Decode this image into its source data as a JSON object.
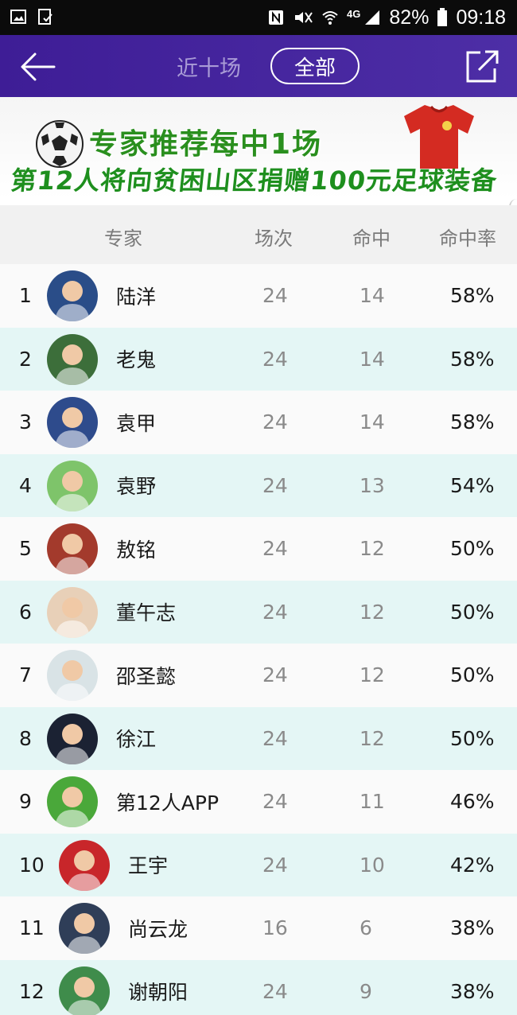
{
  "status_bar": {
    "network": "4G",
    "battery": "82%",
    "time": "09:18"
  },
  "nav": {
    "title": "近十场",
    "filter_label": "全部"
  },
  "banner": {
    "line1": "专家推荐每中1场",
    "line2": "第12人将向贫困山区捐赠100元足球装备"
  },
  "table": {
    "headers": {
      "expert": "专家",
      "games": "场次",
      "hits": "命中",
      "rate": "命中率"
    },
    "rows": [
      {
        "rank": "1",
        "name": "陆洋",
        "games": "24",
        "hits": "14",
        "rate": "58%",
        "avatar_color": "#2a4d88"
      },
      {
        "rank": "2",
        "name": "老鬼",
        "games": "24",
        "hits": "14",
        "rate": "58%",
        "avatar_color": "#3c6e3a"
      },
      {
        "rank": "3",
        "name": "袁甲",
        "games": "24",
        "hits": "14",
        "rate": "58%",
        "avatar_color": "#2e4b8c"
      },
      {
        "rank": "4",
        "name": "袁野",
        "games": "24",
        "hits": "13",
        "rate": "54%",
        "avatar_color": "#7ec46a"
      },
      {
        "rank": "5",
        "name": "敖铭",
        "games": "24",
        "hits": "12",
        "rate": "50%",
        "avatar_color": "#a33a2c"
      },
      {
        "rank": "6",
        "name": "董午志",
        "games": "24",
        "hits": "12",
        "rate": "50%",
        "avatar_color": "#e8d0b8"
      },
      {
        "rank": "7",
        "name": "邵圣懿",
        "games": "24",
        "hits": "12",
        "rate": "50%",
        "avatar_color": "#d9e3e6"
      },
      {
        "rank": "8",
        "name": "徐江",
        "games": "24",
        "hits": "12",
        "rate": "50%",
        "avatar_color": "#1b2233"
      },
      {
        "rank": "9",
        "name": "第12人APP",
        "games": "24",
        "hits": "11",
        "rate": "46%",
        "avatar_color": "#4aa83a"
      },
      {
        "rank": "10",
        "name": "王宇",
        "games": "24",
        "hits": "10",
        "rate": "42%",
        "avatar_color": "#c8262a"
      },
      {
        "rank": "11",
        "name": "尚云龙",
        "games": "16",
        "hits": "6",
        "rate": "38%",
        "avatar_color": "#2f3e58"
      },
      {
        "rank": "12",
        "name": "谢朝阳",
        "games": "24",
        "hits": "9",
        "rate": "38%",
        "avatar_color": "#3f8c4b"
      }
    ]
  }
}
